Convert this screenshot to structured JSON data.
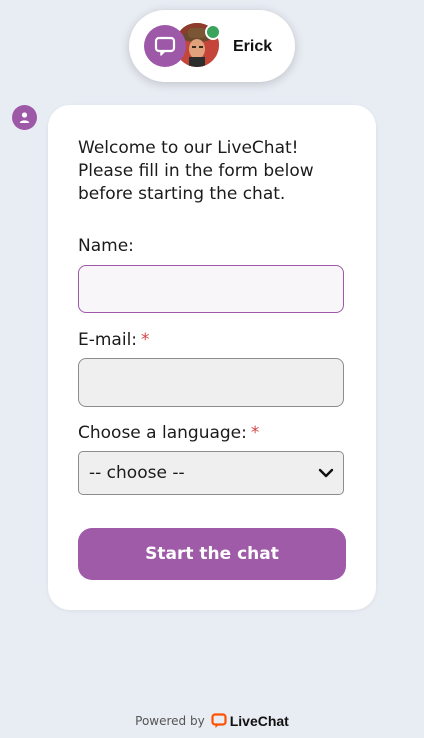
{
  "agent": {
    "name": "Erick",
    "status": "online"
  },
  "welcome_text": "Welcome to our LiveChat! Please fill in the form below before starting the chat.",
  "form": {
    "name_label": "Name:",
    "name_value": "",
    "email_label": "E-mail:",
    "email_value": "",
    "email_required_mark": "*",
    "language_label": "Choose a language:",
    "language_required_mark": "*",
    "language_selected": "-- choose --"
  },
  "start_button_label": "Start the chat",
  "footer": {
    "powered_by": "Powered by",
    "brand": "LiveChat"
  },
  "colors": {
    "accent": "#a05ba8",
    "online": "#3aa35c",
    "required": "#d64545",
    "brand_orange": "#ff5100"
  },
  "icons": [
    "chat-bubble-icon",
    "user-icon",
    "chevron-down-icon",
    "livechat-logo-icon"
  ]
}
